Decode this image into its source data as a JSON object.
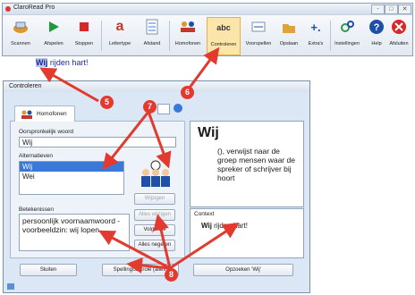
{
  "app": {
    "title": "ClaroRead Pro",
    "window_buttons": [
      "-",
      "□",
      "✕"
    ]
  },
  "toolbar": {
    "items": [
      {
        "label": "Scannen",
        "icon": "scan-icon"
      },
      {
        "label": "Afspelen",
        "icon": "play-icon"
      },
      {
        "label": "Stoppen",
        "icon": "stop-icon"
      },
      {
        "label": "Lettertype",
        "icon": "font-icon"
      },
      {
        "label": "Afstand",
        "icon": "spacing-icon"
      },
      {
        "label": "Homofonen",
        "icon": "homophones-icon"
      },
      {
        "label": "Controleren",
        "icon": "spellcheck-icon"
      },
      {
        "label": "Voorspellen",
        "icon": "predict-icon"
      },
      {
        "label": "Opslaan",
        "icon": "save-icon"
      },
      {
        "label": "Extra's",
        "icon": "extras-icon"
      },
      {
        "label": "Instellingen",
        "icon": "settings-icon"
      },
      {
        "label": "Help",
        "icon": "help-icon"
      },
      {
        "label": "Afsluiten",
        "icon": "close-icon"
      }
    ],
    "active": "Controleren",
    "icon_glyphs": {
      "spell": "abc",
      "font": "a",
      "extras": "+."
    }
  },
  "document": {
    "word": "Wij",
    "rest": " rijden hart!"
  },
  "dialog": {
    "title": "Controleren",
    "tab_label": "Homofonen",
    "original_label": "Oorspronkelijk woord",
    "original_value": "Wij",
    "alternatives_label": "Alternatieven",
    "alternatives": [
      "Wij",
      "Wei"
    ],
    "selected_alternative": "Wij",
    "meanings_label": "Betekenissen",
    "meanings_text": "persoonlijk voornaamwoord - voorbeeldzin: wij lopen",
    "buttons": {
      "wijzigen": "Wijzigen",
      "alles_wijzigen": "Alles wijzigen",
      "volgende": "Volgende",
      "alles_negeren": "Alles negeren",
      "sluiten": "Sluiten",
      "spelling": "Spellingcontrole (alles)",
      "opzoeken": "Opzoeken 'Wij'"
    },
    "definition_word": "Wij",
    "definition_text": "(), verwijst naar de groep mensen waar de spreker of schrijver bij hoort",
    "context_label": "Context",
    "context_word": "Wij",
    "context_rest": " rijden hart!"
  },
  "callouts": [
    "5",
    "6",
    "7",
    "8"
  ],
  "colors": {
    "callout": "#e23a2e",
    "selection": "#3a79d8",
    "active_tool": "#fbe5a8"
  }
}
